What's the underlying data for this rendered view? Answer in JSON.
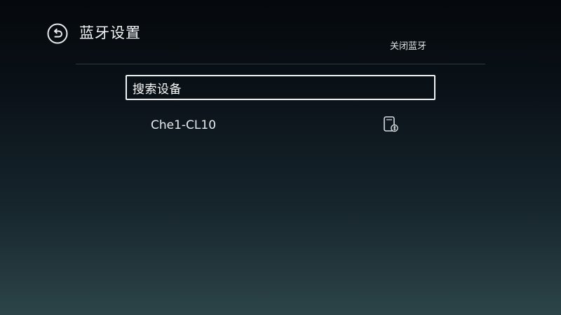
{
  "header": {
    "back_icon": "back-arrow-circle-icon",
    "title": "蓝牙设置",
    "toggle_label": "关闭蓝牙"
  },
  "list": {
    "search_label": "搜索设备",
    "devices": [
      {
        "name": "Che1-CL10",
        "icon": "phone-device-icon"
      }
    ]
  },
  "colors": {
    "text": "#f2f4f5",
    "focus_border": "#f1f3f4",
    "divider": "#2f3b42",
    "bg_top": "#05080c",
    "bg_bottom": "#2c4448"
  }
}
